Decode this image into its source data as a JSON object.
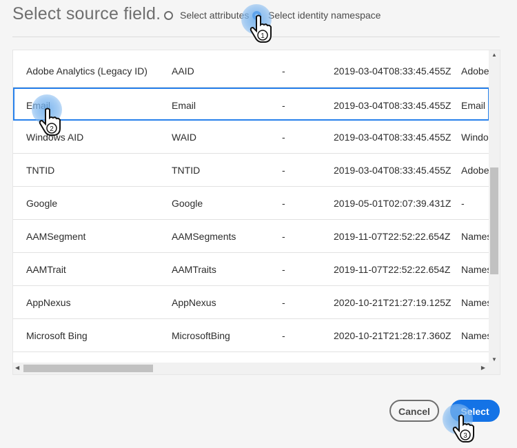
{
  "dialog": {
    "title": "Select source field."
  },
  "source_options": {
    "attributes_label": "Select attributes",
    "identity_label": "Select identity namespace",
    "selected": "identity"
  },
  "table": {
    "rows": [
      {
        "name": "Adobe Analytics (Legacy ID)",
        "code": "AAID",
        "dash": "-",
        "date": "2019-03-04T08:33:45.455Z",
        "extra": "Adobe"
      },
      {
        "name": "Email",
        "code": "Email",
        "dash": "-",
        "date": "2019-03-04T08:33:45.455Z",
        "extra": "Email"
      },
      {
        "name": "Windows AID",
        "code": "WAID",
        "dash": "-",
        "date": "2019-03-04T08:33:45.455Z",
        "extra": "Windo"
      },
      {
        "name": "TNTID",
        "code": "TNTID",
        "dash": "-",
        "date": "2019-03-04T08:33:45.455Z",
        "extra": "Adobe"
      },
      {
        "name": "Google",
        "code": "Google",
        "dash": "-",
        "date": "2019-05-01T02:07:39.431Z",
        "extra": "-"
      },
      {
        "name": "AAMSegment",
        "code": "AAMSegments",
        "dash": "-",
        "date": "2019-11-07T22:52:22.654Z",
        "extra": "Names"
      },
      {
        "name": "AAMTrait",
        "code": "AAMTraits",
        "dash": "-",
        "date": "2019-11-07T22:52:22.654Z",
        "extra": "Names"
      },
      {
        "name": "AppNexus",
        "code": "AppNexus",
        "dash": "-",
        "date": "2020-10-21T21:27:19.125Z",
        "extra": "Names"
      },
      {
        "name": "Microsoft Bing",
        "code": "MicrosoftBing",
        "dash": "-",
        "date": "2020-10-21T21:28:17.360Z",
        "extra": "Names"
      }
    ],
    "selected_row": 1
  },
  "footer": {
    "cancel_label": "Cancel",
    "select_label": "Select"
  },
  "step_markers": [
    "1",
    "2",
    "3"
  ],
  "colors": {
    "accent": "#1473e6",
    "selection_border": "#2680eb",
    "background": "#f5f5f5"
  }
}
